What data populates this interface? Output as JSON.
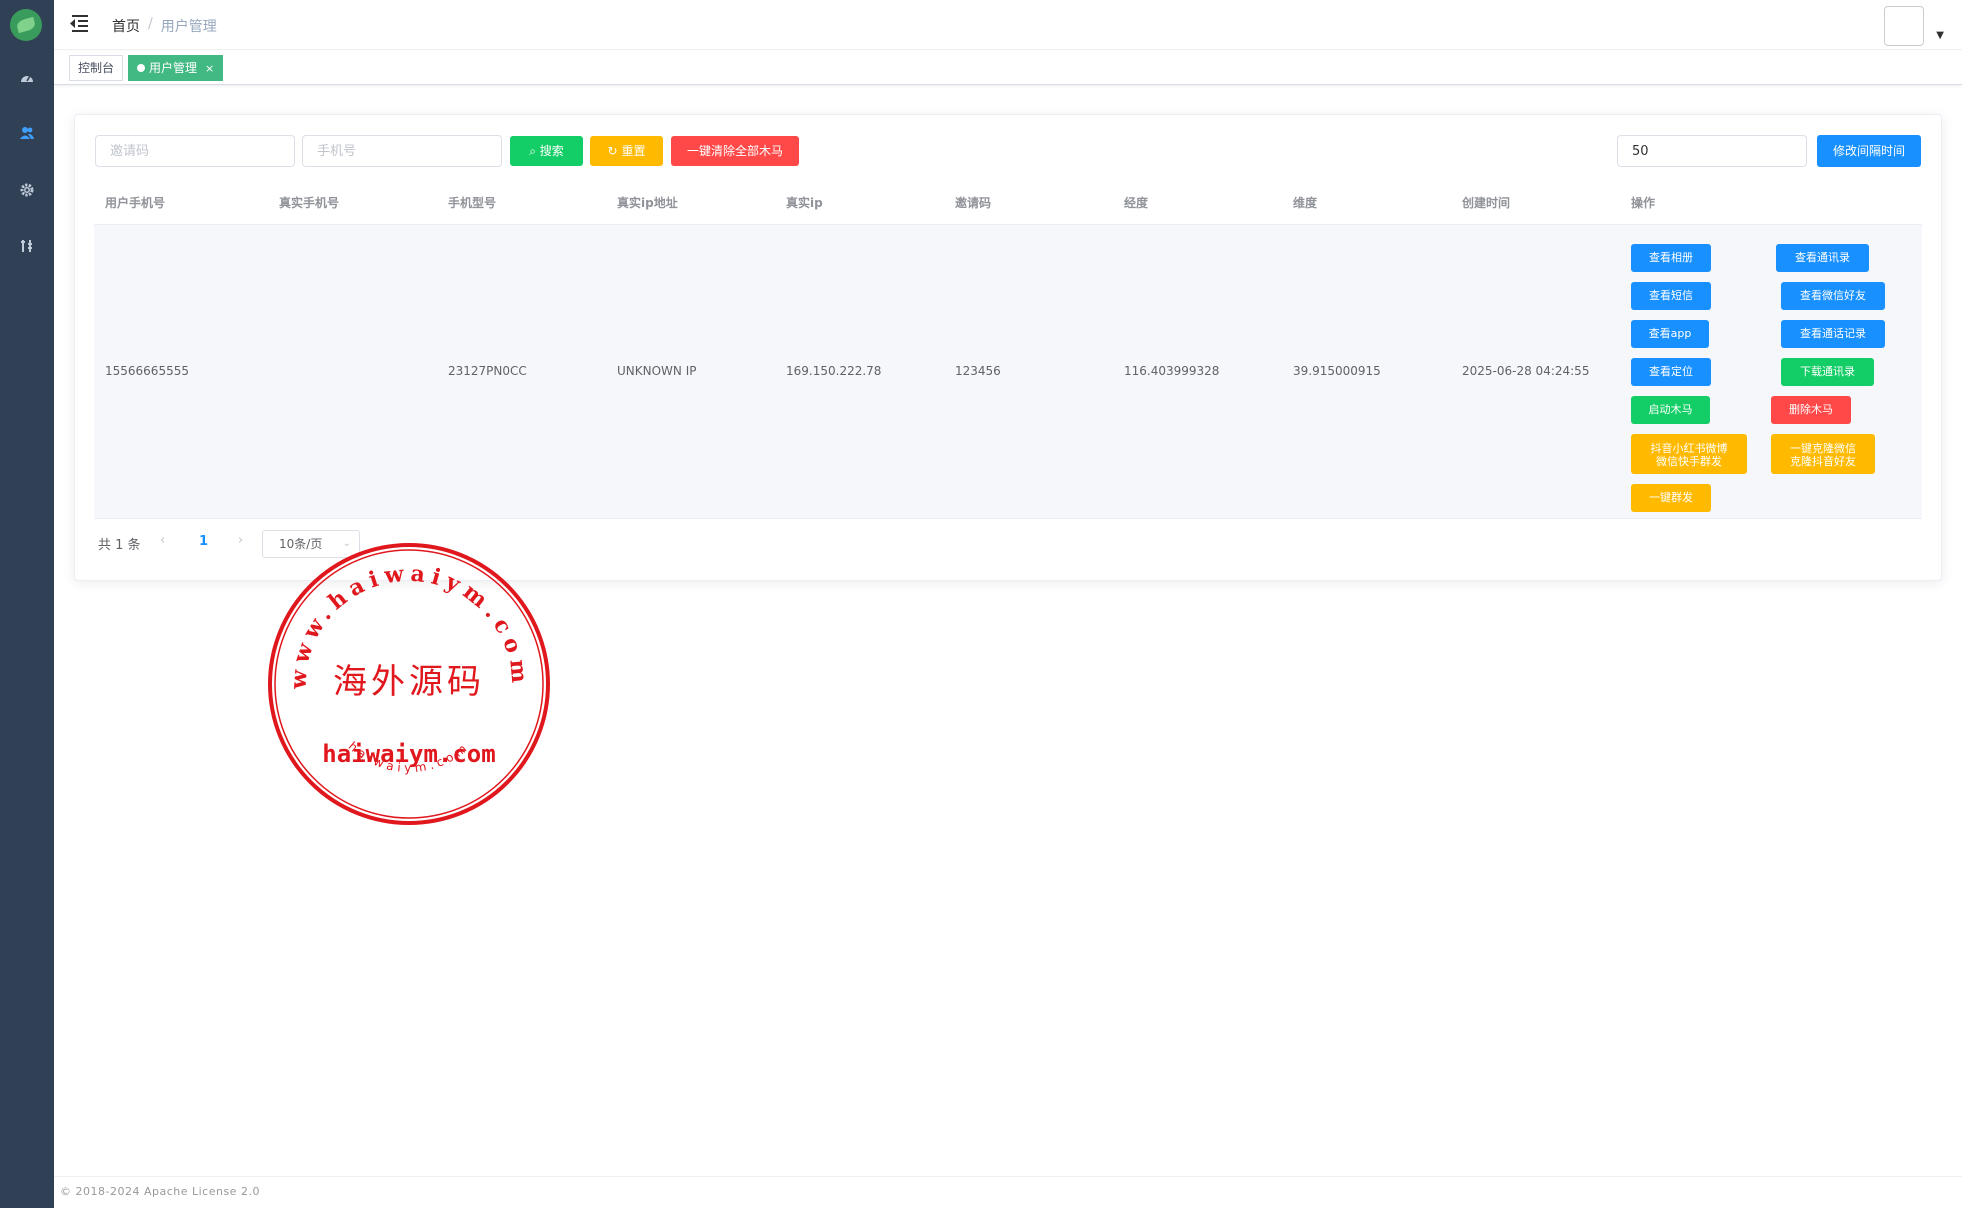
{
  "header": {
    "breadcrumb_home": "首页",
    "breadcrumb_sep": "/",
    "breadcrumb_current": "用户管理"
  },
  "tags": {
    "dashboard": "控制台",
    "users": "用户管理",
    "close": "×"
  },
  "search": {
    "invite_placeholder": "邀请码",
    "phone_placeholder": "手机号",
    "search_label": "搜索",
    "reset_label": "重置",
    "clear_all_label": "一键清除全部木马",
    "interval_value": "50",
    "interval_button": "修改间隔时间"
  },
  "table": {
    "columns": [
      "用户手机号",
      "真实手机号",
      "手机型号",
      "真实ip地址",
      "真实ip",
      "邀请码",
      "经度",
      "维度",
      "创建时间",
      "操作"
    ],
    "rows": [
      {
        "user_phone": "15566665555",
        "real_phone": "",
        "model": "23127PN0CC",
        "ip_addr": "UNKNOWN IP",
        "ip": "169.150.222.78",
        "invite": "123456",
        "lng": "116.403999328",
        "lat": "39.915000915",
        "created": "2025-06-28 04:24:55"
      }
    ],
    "ops": {
      "album": "查看相册",
      "contacts": "查看通讯录",
      "sms": "查看短信",
      "wechat_friends": "查看微信好友",
      "app": "查看app",
      "call_log": "查看通话记录",
      "location": "查看定位",
      "download_contacts": "下载通讯录",
      "start_trojan": "启动木马",
      "delete_trojan": "删除木马",
      "mass_send_social_line1": "抖音小红书微博",
      "mass_send_social_line2": "微信快手群发",
      "clone_friends_line1": "一键克隆微信",
      "clone_friends_line2": "克隆抖音好友",
      "mass_send": "一键群发"
    }
  },
  "pagination": {
    "total": "共 1 条",
    "prev": "‹",
    "page": "1",
    "next": "›",
    "page_size": "10条/页"
  },
  "footer": {
    "copyright": "© 2018-2024 Apache License 2.0"
  },
  "stamp": {
    "top_text": "www.haiwaiym.com",
    "center_text": "海外源码",
    "middle_text": "haiwaiym.com",
    "bottom_text": "haiwaiym.com"
  },
  "colors": {
    "sidebar": "#304156",
    "primary": "#1890ff",
    "success": "#13ce66",
    "warning": "#ffba00",
    "danger": "#ff4949",
    "tag_active": "#42b983",
    "stamp": "#e0171d"
  }
}
